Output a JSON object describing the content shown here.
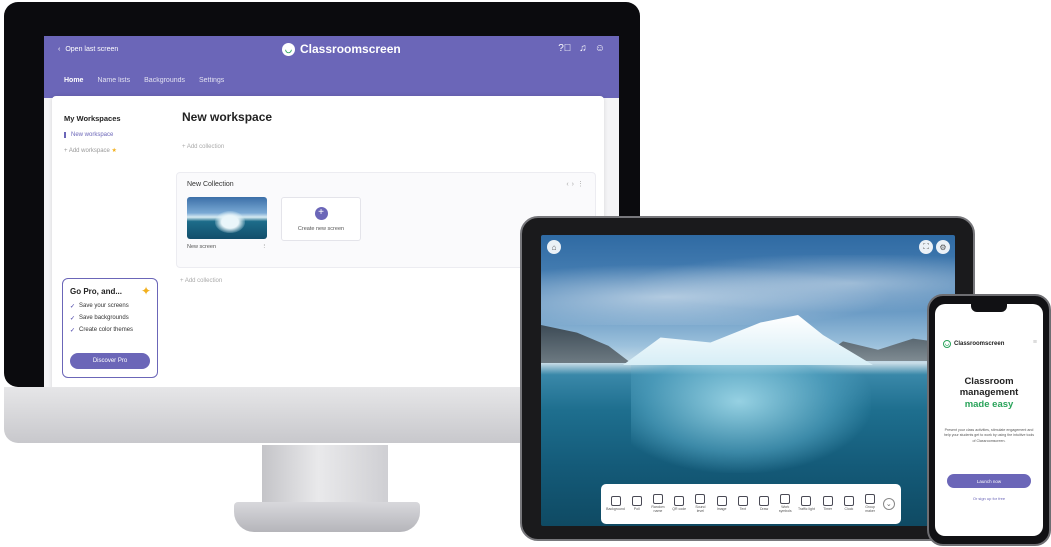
{
  "desktop": {
    "topbar": {
      "back_label": "Open last screen",
      "brand": "Classroomscreen",
      "nav": [
        "Home",
        "Name lists",
        "Backgrounds",
        "Settings"
      ],
      "icons": [
        "help-icon",
        "bell-icon",
        "user-icon"
      ]
    },
    "sidebar": {
      "title": "My Workspaces",
      "active_workspace": "New workspace",
      "add_workspace": "+ Add workspace"
    },
    "pro_card": {
      "title": "Go Pro, and...",
      "features": [
        "Save your screens",
        "Save backgrounds",
        "Create color themes"
      ],
      "button": "Discover Pro"
    },
    "main": {
      "workspace_title": "New workspace",
      "add_collection_top": "+ Add collection",
      "collection_title": "New Collection",
      "screen_label": "New screen",
      "create_new_screen": "Create new screen",
      "add_collection_bottom": "+ Add collection"
    }
  },
  "tablet": {
    "toolbar": [
      "Background",
      "Poll",
      "Random name",
      "QR code",
      "Sound level",
      "Image",
      "Text",
      "Draw",
      "Work symbols",
      "Traffic light",
      "Timer",
      "Clock",
      "Group maker"
    ]
  },
  "phone": {
    "brand": "Classroomscreen",
    "title_line1": "Classroom",
    "title_line2": "management",
    "title_accent": "made easy",
    "body": "Present your class activities, stimulate engagement and help your students get to work by using the intuitive tools of Classroomscreen.",
    "primary_button": "Launch now",
    "secondary_link": "Or sign up for free"
  },
  "colors": {
    "brand_purple": "#6b66b8",
    "brand_green": "#29a35a",
    "accent_yellow": "#f2b01e"
  }
}
